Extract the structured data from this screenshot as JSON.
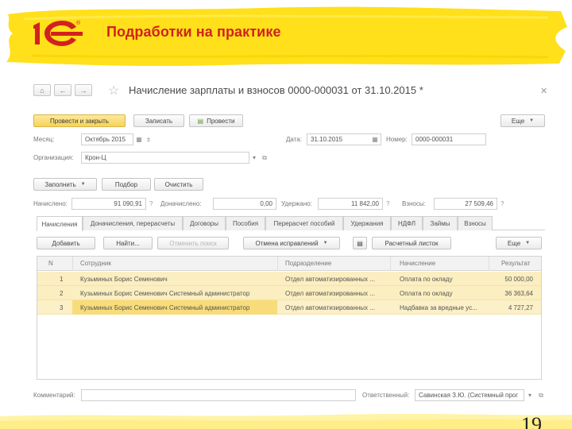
{
  "slide": {
    "title": "Подработки на практике",
    "page_number": "19",
    "colors": {
      "title": "#d2211e",
      "brush": "#ffe01a",
      "logo": "#d2211e"
    }
  },
  "window": {
    "title": "Начисление зарплаты и взносов 0000-000031 от 31.10.2015 *",
    "nav": {
      "home_icon": "home-icon",
      "back_icon": "arrow-left-icon",
      "forward_icon": "arrow-right-icon",
      "favorite_icon": "star-icon",
      "close_icon": "close-icon"
    }
  },
  "toolbar": {
    "post_close": "Провести и закрыть",
    "save": "Записать",
    "post": "Провести",
    "more": "Еще"
  },
  "header_fields": {
    "month_label": "Месяц:",
    "month_value": "Октябрь 2015",
    "date_label": "Дата:",
    "date_value": "31.10.2015",
    "number_label": "Номер:",
    "number_value": "0000-000031",
    "org_label": "Организация:",
    "org_value": "Крон-Ц"
  },
  "actions": {
    "fill": "Заполнить",
    "pick": "Подбор",
    "clear": "Очистить"
  },
  "totals": {
    "accrued_label": "Начислено:",
    "accrued_value": "91 090,91",
    "additional_label": "Доначислено:",
    "additional_value": "0,00",
    "withheld_label": "Удержано:",
    "withheld_value": "11 842,00",
    "contrib_label": "Взносы:",
    "contrib_value": "27 509,46",
    "help_mark": "?"
  },
  "tabs": [
    "Начисления",
    "Доначисления, перерасчеты",
    "Договоры",
    "Пособия",
    "Перерасчет пособий",
    "Удержания",
    "НДФЛ",
    "Займы",
    "Взносы"
  ],
  "table_toolbar": {
    "add": "Добавить",
    "find": "Найти...",
    "cancel_search": "Отменить поиск",
    "cancel_corrections": "Отмена исправлений",
    "payslip": "Расчетный листок",
    "more": "Еще"
  },
  "table": {
    "columns": [
      "N",
      "Сотрудник",
      "Подразделение",
      "Начисление",
      "Результат"
    ],
    "rows": [
      [
        "1",
        "Кузьминых Борис Семенович",
        "Отдел автоматизированных ...",
        "Оплата по окладу",
        "50 000,00"
      ],
      [
        "2",
        "Кузьминых Борис Семенович Системный администратор",
        "Отдел автоматизированных ...",
        "Оплата по окладу",
        "36 363,64"
      ],
      [
        "3",
        "Кузьминых Борис Семенович Системный администратор",
        "Отдел автоматизированных ...",
        "Надбавка за вредные ус...",
        "4 727,27"
      ]
    ]
  },
  "footer": {
    "comment_label": "Комментарий:",
    "comment_value": "",
    "responsible_label": "Ответственный:",
    "responsible_value": "Савинская З.Ю. (Системный прог"
  }
}
